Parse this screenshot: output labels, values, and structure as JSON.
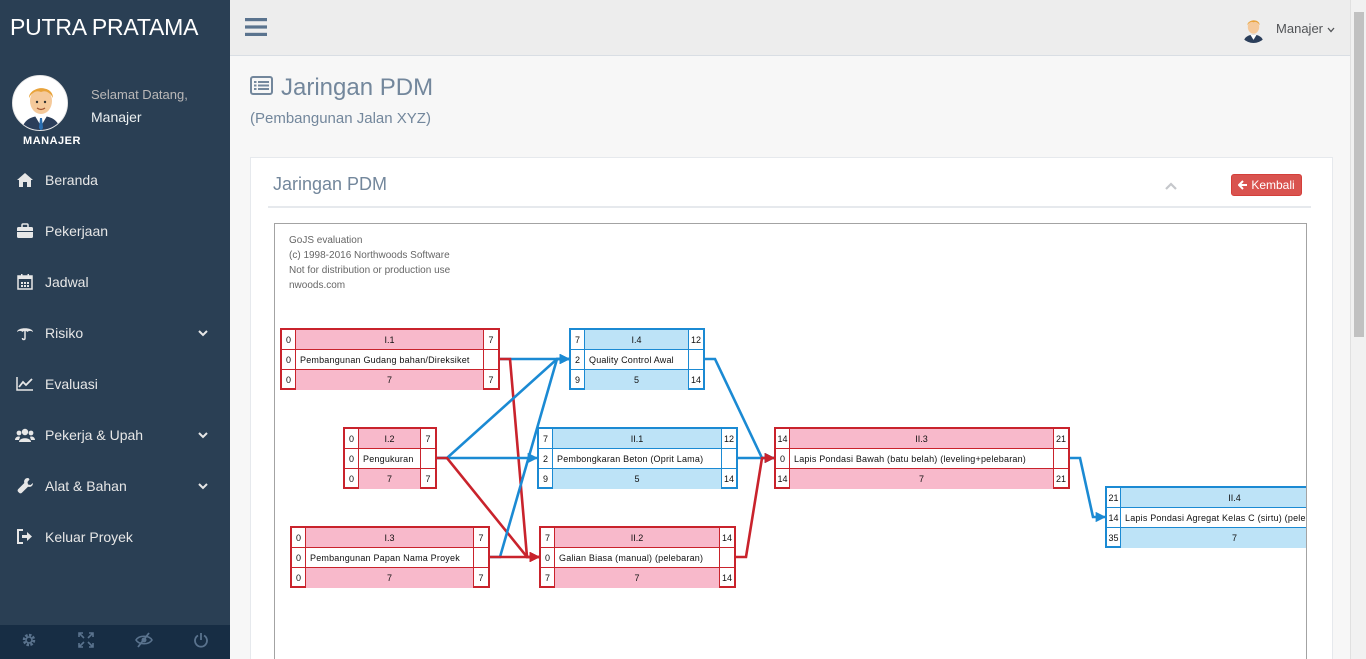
{
  "brand": "PUTRA PRATAMA",
  "profile": {
    "welcome": "Selamat Datang,",
    "name": "Manajer",
    "role": "MANAJER"
  },
  "menu": [
    {
      "label": "Beranda",
      "icon": "home-icon",
      "has_sub": false
    },
    {
      "label": "Pekerjaan",
      "icon": "briefcase-icon",
      "has_sub": false
    },
    {
      "label": "Jadwal",
      "icon": "calendar-icon",
      "has_sub": false
    },
    {
      "label": "Risiko",
      "icon": "umbrella-icon",
      "has_sub": true
    },
    {
      "label": "Evaluasi",
      "icon": "line-chart-icon",
      "has_sub": false
    },
    {
      "label": "Pekerja & Upah",
      "icon": "users-icon",
      "has_sub": true
    },
    {
      "label": "Alat & Bahan",
      "icon": "wrench-icon",
      "has_sub": true
    },
    {
      "label": "Keluar Proyek",
      "icon": "sign-out-icon",
      "has_sub": false
    }
  ],
  "footer_icons": [
    "settings-icon",
    "fullscreen-icon",
    "eye-slash-icon",
    "power-icon"
  ],
  "topnav": {
    "user": "Manajer"
  },
  "page": {
    "title": "Jaringan PDM",
    "subtitle": "(Pembangunan Jalan XYZ)"
  },
  "panel": {
    "title": "Jaringan PDM",
    "back_button": "Kembali"
  },
  "watermark": [
    "GoJS evaluation",
    "(c) 1998-2016 Northwoods Software",
    "Not for distribution or production use",
    "nwoods.com"
  ],
  "colors": {
    "critical": "#c9232c",
    "noncritical": "#1b8ad3",
    "critical_fill": "#f8b9cb",
    "noncritical_fill": "#bde3f7",
    "back_button": "#d9534f"
  },
  "nodes": [
    {
      "id": "I.1",
      "name": "Pembangunan Gudang bahan/Direksiket",
      "es": "0",
      "ef": "7",
      "dur": "0",
      "ls": "0",
      "lf": "7",
      "slack": "7",
      "critical": true
    },
    {
      "id": "I.2",
      "name": "Pengukuran",
      "es": "0",
      "ef": "7",
      "dur": "0",
      "ls": "0",
      "lf": "7",
      "slack": "7",
      "critical": true
    },
    {
      "id": "I.3",
      "name": "Pembangunan Papan Nama Proyek",
      "es": "0",
      "ef": "7",
      "dur": "0",
      "ls": "0",
      "lf": "7",
      "slack": "7",
      "critical": true
    },
    {
      "id": "I.4",
      "name": "Quality Control Awal",
      "es": "7",
      "ef": "12",
      "dur": "2",
      "ls": "9",
      "lf": "14",
      "slack": "5",
      "critical": false
    },
    {
      "id": "II.1",
      "name": "Pembongkaran Beton (Oprit Lama)",
      "es": "7",
      "ef": "12",
      "dur": "2",
      "ls": "9",
      "lf": "14",
      "slack": "5",
      "critical": false
    },
    {
      "id": "II.2",
      "name": "Galian Biasa (manual) (pelebaran)",
      "es": "7",
      "ef": "14",
      "dur": "0",
      "ls": "7",
      "lf": "14",
      "slack": "7",
      "critical": true
    },
    {
      "id": "II.3",
      "name": "Lapis Pondasi Bawah (batu belah) (leveling+pelebaran)",
      "es": "14",
      "ef": "21",
      "dur": "0",
      "ls": "14",
      "lf": "21",
      "slack": "7",
      "critical": true
    },
    {
      "id": "II.4",
      "name": "Lapis Pondasi Agregat Kelas C (sirtu) (pelebaran)",
      "es": "21",
      "ef": "",
      "dur": "14",
      "ls": "35",
      "lf": "",
      "slack": "7",
      "critical": false
    }
  ],
  "links": [
    {
      "from": "I.1",
      "to": "I.4",
      "critical": false
    },
    {
      "from": "I.1",
      "to": "II.2",
      "critical": true
    },
    {
      "from": "I.2",
      "to": "I.4",
      "critical": false
    },
    {
      "from": "I.2",
      "to": "II.1",
      "critical": false
    },
    {
      "from": "I.2",
      "to": "II.2",
      "critical": true
    },
    {
      "from": "I.3",
      "to": "I.4",
      "critical": false
    },
    {
      "from": "I.3",
      "to": "II.2",
      "critical": true
    },
    {
      "from": "I.4",
      "to": "II.3",
      "critical": false
    },
    {
      "from": "II.1",
      "to": "II.3",
      "critical": false
    },
    {
      "from": "II.2",
      "to": "II.3",
      "critical": true
    },
    {
      "from": "II.3",
      "to": "II.4",
      "critical": false
    }
  ]
}
